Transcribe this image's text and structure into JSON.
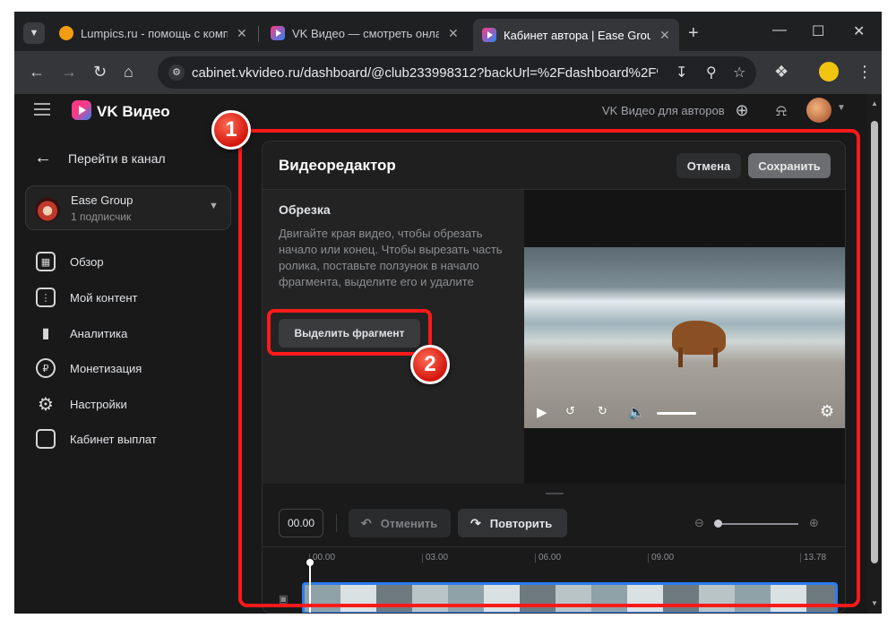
{
  "browser": {
    "tabs": [
      {
        "title": "Lumpics.ru - помощь с компь",
        "favicon": "orange-circle-icon"
      },
      {
        "title": "VK Видео — смотреть онлайн",
        "favicon": "vk-video-icon"
      },
      {
        "title": "Кабинет автора | Ease Group",
        "favicon": "vk-video-icon",
        "active": true
      }
    ],
    "url": "cabinet.vkvideo.ru/dashboard/@club233998312?backUrl=%2Fdashboard%2F%40cl..."
  },
  "site": {
    "logo_text": "VK Видео",
    "for_authors": "VK Видео для авторов"
  },
  "sidebar": {
    "back_label": "Перейти в канал",
    "channel": {
      "name": "Ease Group",
      "subscribers": "1 подписчик"
    },
    "items": [
      {
        "label": "Обзор",
        "icon": "grid-icon"
      },
      {
        "label": "Мой контент",
        "icon": "content-icon"
      },
      {
        "label": "Аналитика",
        "icon": "analytics-icon"
      },
      {
        "label": "Монетизация",
        "icon": "ruble-icon"
      },
      {
        "label": "Настройки",
        "icon": "gear-icon"
      },
      {
        "label": "Кабинет выплат",
        "icon": "wallet-icon"
      }
    ]
  },
  "editor": {
    "title": "Видеоредактор",
    "cancel_label": "Отмена",
    "save_label": "Сохранить",
    "trim": {
      "title": "Обрезка",
      "description": "Двигайте края видео, чтобы обрезать начало или конец. Чтобы вырезать часть ролика, поставьте ползунок в начало фрагмента, выделите его и удалите",
      "select_button": "Выделить фрагмент"
    },
    "timeline": {
      "current_time": "00.00",
      "undo_label": "Отменить",
      "redo_label": "Повторить",
      "ticks": [
        "00.00",
        "03.00",
        "06.00",
        "09.00",
        "13.78"
      ]
    }
  },
  "annotations": {
    "badge_1": "1",
    "badge_2": "2",
    "highlight_color": "#ff1a1a"
  }
}
